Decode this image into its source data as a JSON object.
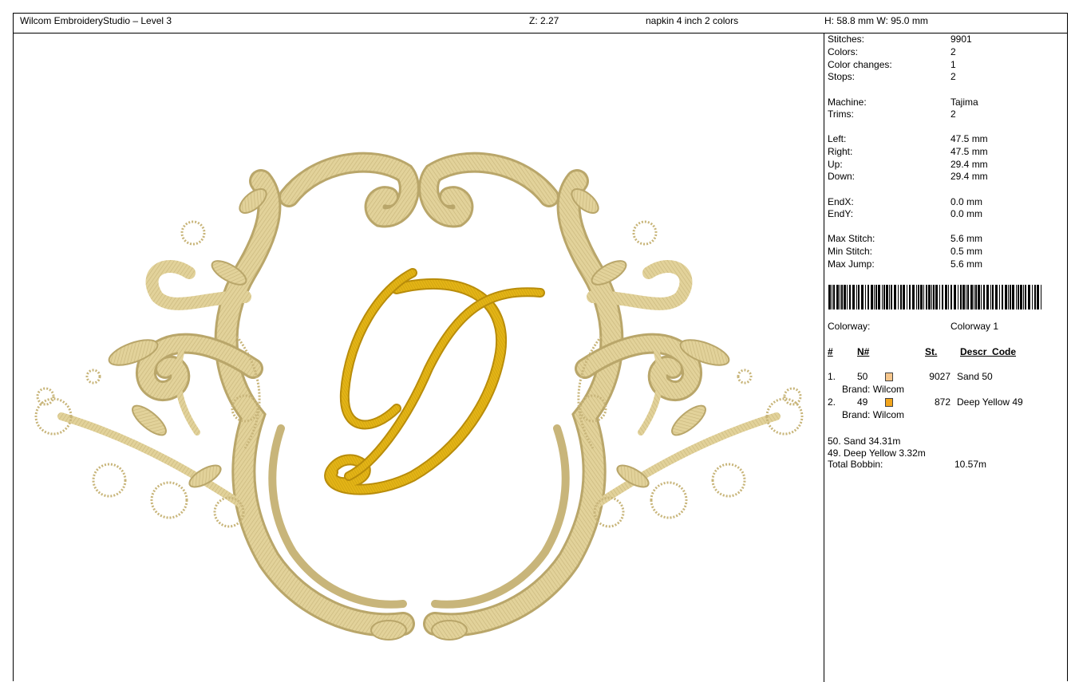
{
  "header": {
    "app_title": "Wilcom EmbroideryStudio – Level 3",
    "zoom": "Z: 2.27",
    "design_name": "napkin 4 inch 2 colors",
    "dimensions": "H: 58.8 mm   W: 95.0 mm"
  },
  "design": {
    "description": "Embroidered monogram crest: ornamental sand-colored baroque frame with floral sprigs and a deep yellow script letter",
    "monogram": "D",
    "colors": {
      "sand": "#E2D29A",
      "sand_dark": "#B9A66A",
      "deep_yellow": "#E3B416",
      "deep_yellow_dark": "#B88C0A"
    }
  },
  "stats": [
    {
      "label": "Stitches:",
      "value": "9901"
    },
    {
      "label": "Colors:",
      "value": "2"
    },
    {
      "label": "Color changes:",
      "value": "1"
    },
    {
      "label": "Stops:",
      "value": "2"
    },
    {
      "label": "Machine:",
      "value": "Tajima"
    },
    {
      "label": "Trims:",
      "value": "2"
    },
    {
      "label": "Left:",
      "value": "47.5 mm"
    },
    {
      "label": "Right:",
      "value": "47.5 mm"
    },
    {
      "label": "Up:",
      "value": "29.4 mm"
    },
    {
      "label": "Down:",
      "value": "29.4 mm"
    },
    {
      "label": "EndX:",
      "value": "0.0 mm"
    },
    {
      "label": "EndY:",
      "value": "0.0 mm"
    },
    {
      "label": "Max Stitch:",
      "value": "5.6 mm"
    },
    {
      "label": "Min Stitch:",
      "value": "0.5 mm"
    },
    {
      "label": "Max Jump:",
      "value": "5.6 mm"
    }
  ],
  "colorway": {
    "label": "Colorway:",
    "value": "Colorway 1"
  },
  "table": {
    "headers": {
      "num": "#",
      "code": "N#",
      "st": "St.",
      "descr": "Descr_Code"
    },
    "rows": [
      {
        "num": "1.",
        "code": "50",
        "color": "#F6C68C",
        "st": "9027",
        "descr": "Sand 50",
        "brand": "Brand: Wilcom"
      },
      {
        "num": "2.",
        "code": "49",
        "color": "#F2A51C",
        "st": "872",
        "descr": "Deep Yellow 49",
        "brand": "Brand: Wilcom"
      }
    ]
  },
  "thread_usage": {
    "line1": "50. Sand 34.31m",
    "line2": "49. Deep Yellow  3.32m",
    "bobbin_label": "Total Bobbin:",
    "bobbin_value": "10.57m"
  }
}
